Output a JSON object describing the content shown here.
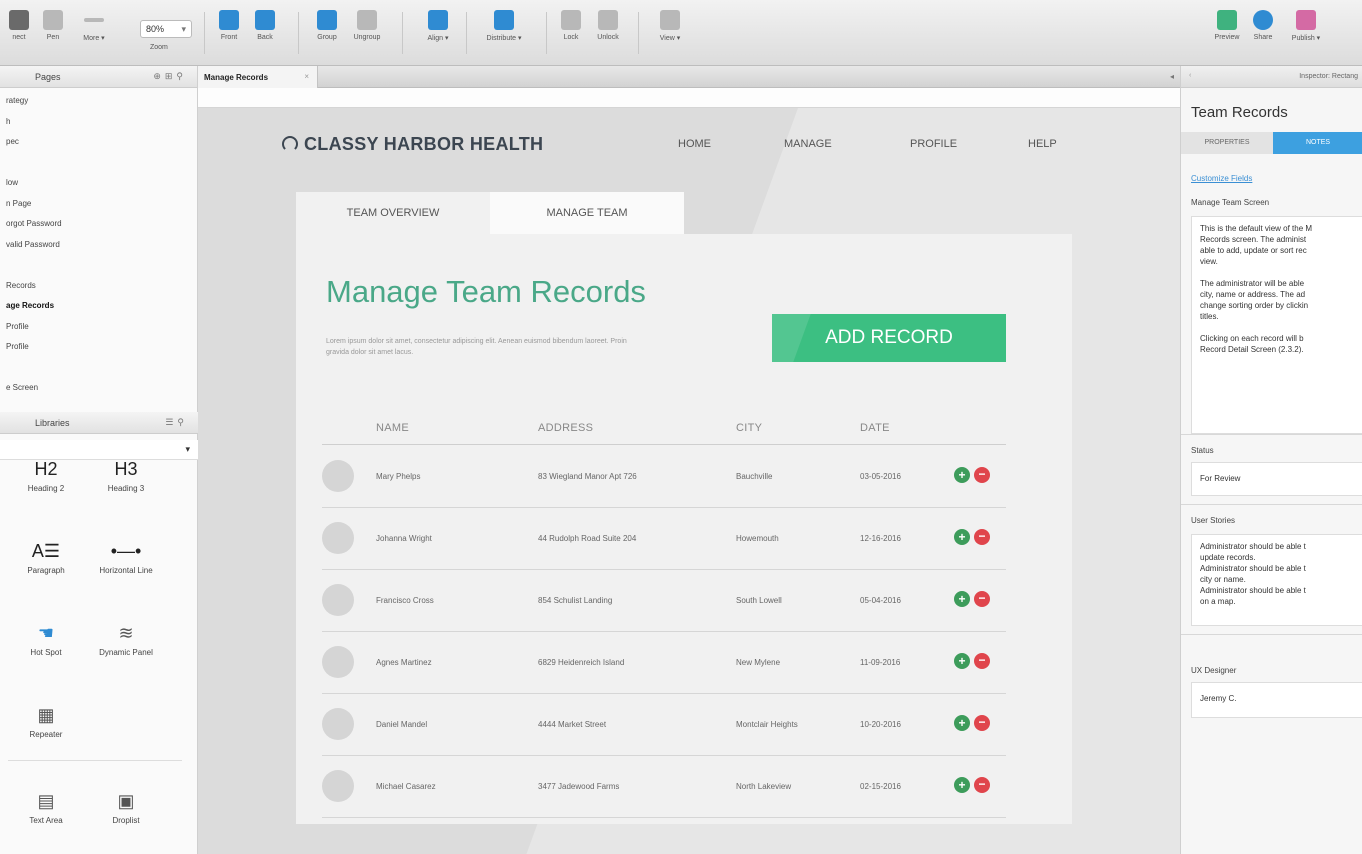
{
  "toolbar": {
    "tools": [
      {
        "label": "nect",
        "icon": "select-icon"
      },
      {
        "label": "Pen",
        "icon": "pen-icon"
      },
      {
        "label": "More ▾",
        "icon": "more-icon"
      }
    ],
    "zoom_value": "80%",
    "zoom_label": "Zoom",
    "front_label": "Front",
    "back_label": "Back",
    "group_label": "Group",
    "ungroup_label": "Ungroup",
    "align_label": "Align ▾",
    "distribute_label": "Distribute ▾",
    "lock_label": "Lock",
    "unlock_label": "Unlock",
    "view_label": "View ▾",
    "preview_label": "Preview",
    "share_label": "Share",
    "publish_label": "Publish ▾"
  },
  "pages_panel": {
    "title": "Pages",
    "items": [
      "rategy",
      "h",
      "pec",
      "",
      "low",
      "n Page",
      "orgot Password",
      "valid Password",
      "",
      "Records",
      "age Records",
      "Profile",
      "Profile",
      "",
      "e Screen"
    ],
    "selected_index": 10
  },
  "libraries_panel": {
    "title": "Libraries",
    "widgets": [
      {
        "glyph": "H2",
        "label": "Heading 2"
      },
      {
        "glyph": "H3",
        "label": "Heading 3"
      },
      {
        "glyph": "A☰",
        "label": "Paragraph"
      },
      {
        "glyph": "•—•",
        "label": "Horizontal Line"
      },
      {
        "glyph": "☚",
        "label": "Hot Spot"
      },
      {
        "glyph": "≋",
        "label": "Dynamic Panel"
      },
      {
        "glyph": "▦",
        "label": "Repeater"
      },
      {
        "glyph": "▤",
        "label": "Text Area"
      },
      {
        "glyph": "▣",
        "label": "Droplist"
      }
    ]
  },
  "canvas": {
    "tab_label": "Manage Records",
    "tab_close": "×",
    "collapse": "◂"
  },
  "site": {
    "brand": "CLASSY HARBOR HEALTH",
    "nav": [
      "HOME",
      "MANAGE",
      "PROFILE",
      "HELP"
    ],
    "tabs": [
      "TEAM OVERVIEW",
      "MANAGE TEAM"
    ],
    "heading": "Manage Team Records",
    "lorem": "Lorem ipsum dolor sit amet, consectetur adipiscing elit. Aenean euismod bibendum laoreet. Proin gravida dolor sit amet lacus.",
    "add_button": "ADD RECORD",
    "columns": [
      "NAME",
      "ADDRESS",
      "CITY",
      "DATE"
    ],
    "rows": [
      {
        "name": "Mary Phelps",
        "address": "83 Wiegland Manor Apt 726",
        "city": "Bauchville",
        "date": "03-05-2016"
      },
      {
        "name": "Johanna Wright",
        "address": "44 Rudolph Road Suite 204",
        "city": "Howemouth",
        "date": "12-16-2016"
      },
      {
        "name": "Francisco Cross",
        "address": "854 Schulist Landing",
        "city": "South Lowell",
        "date": "05-04-2016"
      },
      {
        "name": "Agnes Martinez",
        "address": "6829 Heidenreich Island",
        "city": "New Mylene",
        "date": "11-09-2016"
      },
      {
        "name": "Daniel Mandel",
        "address": "4444 Market Street",
        "city": "Montclair Heights",
        "date": "10-20-2016"
      },
      {
        "name": "Michael Casarez",
        "address": "3477 Jadewood Farms",
        "city": "North Lakeview",
        "date": "02-15-2016"
      }
    ],
    "add_glyph": "+",
    "remove_glyph": "−"
  },
  "inspector": {
    "header": "Inspector: Rectang",
    "title": "Team Records",
    "tab_properties": "PROPERTIES",
    "tab_notes": "NOTES",
    "customize_link": "Customize Fields",
    "screen_label": "Manage Team Screen",
    "screen_notes": [
      "This is the default view of the M\nRecords screen. The administ\nable to add, update or sort rec\nview.",
      "The administrator will be able\ncity, name or address. The ad\nchange sorting order by clickin\ntitles.",
      "Clicking on each record will b\nRecord Detail Screen (2.3.2)."
    ],
    "status_label": "Status",
    "status_value": "For Review",
    "stories_label": "User Stories",
    "stories_value": "Administrator should be able t\nupdate records.\nAdministrator should be able t\ncity or name.\nAdministrator should be able t\non a map.",
    "designer_label": "UX Designer",
    "designer_value": "Jeremy C."
  }
}
